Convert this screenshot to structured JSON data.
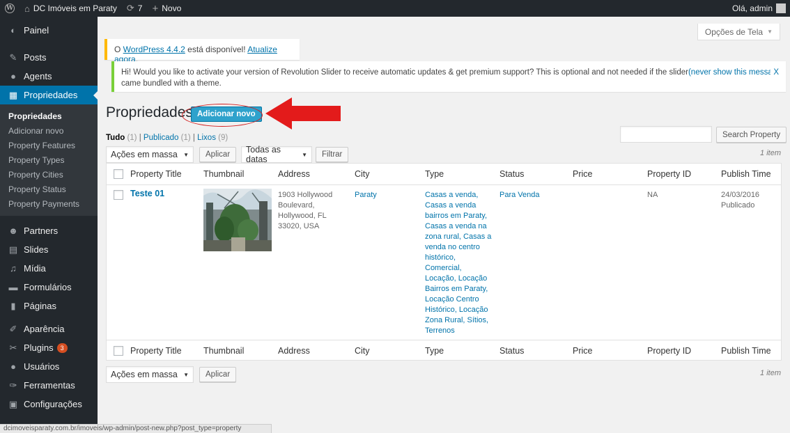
{
  "adminbar": {
    "site_name": "DC Imóveis em Paraty",
    "updates_count": "7",
    "new_label": "Novo",
    "greeting": "Olá, admin"
  },
  "sidebar": {
    "items_top": [
      {
        "label": "Painel",
        "icon": "dashboard-icon"
      },
      {
        "label": "Posts",
        "icon": "pin-icon"
      },
      {
        "label": "Agents",
        "icon": "agents-icon"
      },
      {
        "label": "Propriedades",
        "icon": "building-icon"
      }
    ],
    "submenu": [
      "Propriedades",
      "Adicionar novo",
      "Property Features",
      "Property Types",
      "Property Cities",
      "Property Status",
      "Property Payments"
    ],
    "items_bottom": [
      {
        "label": "Partners",
        "icon": "partners-icon"
      },
      {
        "label": "Slides",
        "icon": "slides-icon"
      },
      {
        "label": "Mídia",
        "icon": "media-icon"
      },
      {
        "label": "Formulários",
        "icon": "forms-icon"
      },
      {
        "label": "Páginas",
        "icon": "pages-icon"
      },
      {
        "label": "Aparência",
        "icon": "brush-icon"
      },
      {
        "label": "Plugins",
        "icon": "plugin-icon",
        "badge": "3"
      },
      {
        "label": "Usuários",
        "icon": "users-icon"
      },
      {
        "label": "Ferramentas",
        "icon": "wrench-icon"
      },
      {
        "label": "Configurações",
        "icon": "settings-icon"
      }
    ]
  },
  "screen_options": "Opções de Tela",
  "notices": {
    "update_prefix": "O ",
    "update_link": "WordPress 4.4.2",
    "update_mid": " está disponível! ",
    "update_action": "Atualize agora",
    "update_suffix": ".",
    "slider_text": "Hi! Would you like to activate your version of Revolution Slider to receive automatic updates & get premium support? This is optional and not needed if the slider",
    "slider_link": "(never show this message again)",
    "slider_dismiss": "X",
    "slider_tail": "came bundled with a theme."
  },
  "page": {
    "title": "Propriedades",
    "add_new": "Adicionar novo"
  },
  "filters": {
    "all_label": "Tudo",
    "all_count": "(1)",
    "published_label": "Publicado",
    "published_count": "(1)",
    "trash_label": "Lixos",
    "trash_count": "(9)",
    "sep": "|",
    "bulk_actions": "Ações em massa",
    "apply": "Aplicar",
    "all_dates": "Todas as datas",
    "filter": "Filtrar",
    "search_button": "Search Property",
    "items_count": "1 item"
  },
  "table": {
    "columns": [
      "Property Title",
      "Thumbnail",
      "Address",
      "City",
      "Type",
      "Status",
      "Price",
      "Property ID",
      "Publish Time"
    ],
    "rows": [
      {
        "title": "Teste 01",
        "address": "1903 Hollywood Boulevard, Hollywood, FL 33020, USA",
        "city": "Paraty",
        "type": "Casas a venda, Casas a venda bairros em Paraty, Casas a venda na zona rural, Casas a venda no centro histórico, Comercial, Locação, Locação Bairros em Paraty, Locação Centro Histórico, Locação Zona Rural, Sítios, Terrenos",
        "status": "Para Venda",
        "price": "",
        "property_id": "NA",
        "publish_date": "24/03/2016",
        "publish_state": "Publicado"
      }
    ]
  },
  "status_url": "dcimoveisparaty.com.br/imoveis/wp-admin/post-new.php?post_type=property",
  "colors": {
    "admin_dark": "#23282d",
    "accent": "#0073aa",
    "button_primary": "#2ea2cc",
    "annotation_red": "#e31b1b"
  }
}
